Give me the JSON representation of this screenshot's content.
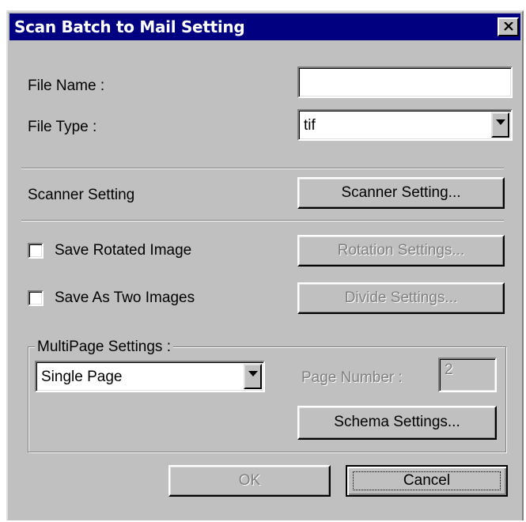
{
  "dialog": {
    "title": "Scan Batch to Mail Setting"
  },
  "file_name": {
    "label": "File Name :",
    "value": ""
  },
  "file_type": {
    "label": "File Type :",
    "value": "tif"
  },
  "scanner": {
    "label": "Scanner Setting",
    "button": "Scanner Setting..."
  },
  "rotated": {
    "label": "Save Rotated Image",
    "checked": false,
    "button": "Rotation Settings..."
  },
  "two_images": {
    "label": "Save As Two Images",
    "checked": false,
    "button": "Divide Settings..."
  },
  "multipage": {
    "group_label": "MultiPage Settings :",
    "selected": "Single Page",
    "page_number_label": "Page Number :",
    "page_number_value": "2",
    "schema_button": "Schema Settings..."
  },
  "footer": {
    "ok": "OK",
    "cancel": "Cancel"
  },
  "icons": [
    "close-icon",
    "dropdown-arrow-icon"
  ]
}
